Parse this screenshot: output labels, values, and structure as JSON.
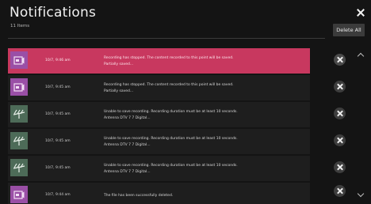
{
  "header": {
    "title": "Notifications",
    "count": "11 Items",
    "delete_all_label": "Delete All"
  },
  "icons": {
    "recording": "recording-icon",
    "antenna": "antenna-icon",
    "close": "close-icon",
    "remove": "remove-icon",
    "chevron_up": "chevron-up-icon",
    "chevron_down": "chevron-down-icon"
  },
  "colors": {
    "selected_row": "#c8385f",
    "recording_thumb": "#9a4fa6",
    "antenna_thumb": "#4d6b58"
  },
  "notifications": [
    {
      "time": "10/7, 9:46 am",
      "line1": "Recording has stopped. The content recorded to this point will be saved.",
      "line2": "Partially saved...",
      "icon": "recording-icon",
      "selected": true
    },
    {
      "time": "10/7, 9:45 am",
      "line1": "Recording has stopped. The content recorded to this point will be saved.",
      "line2": "Partially saved...",
      "icon": "recording-icon",
      "selected": false
    },
    {
      "time": "10/7, 9:45 am",
      "line1": "Unable to save recording. Recording duration must be at least 10 seconds.",
      "line2": "Antenna DTV 7 7 Digital...",
      "icon": "antenna-icon",
      "selected": false
    },
    {
      "time": "10/7, 9:45 am",
      "line1": "Unable to save recording. Recording duration must be at least 10 seconds.",
      "line2": "Antenna DTV 7 7 Digital...",
      "icon": "antenna-icon",
      "selected": false
    },
    {
      "time": "10/7, 9:45 am",
      "line1": "Unable to save recording. Recording duration must be at least 10 seconds.",
      "line2": "Antenna DTV 7 7 Digital...",
      "icon": "antenna-icon",
      "selected": false
    },
    {
      "time": "10/7, 9:44 am",
      "line1": "The file has been successfully deleted.",
      "line2": "",
      "icon": "recording-icon",
      "selected": false
    }
  ]
}
